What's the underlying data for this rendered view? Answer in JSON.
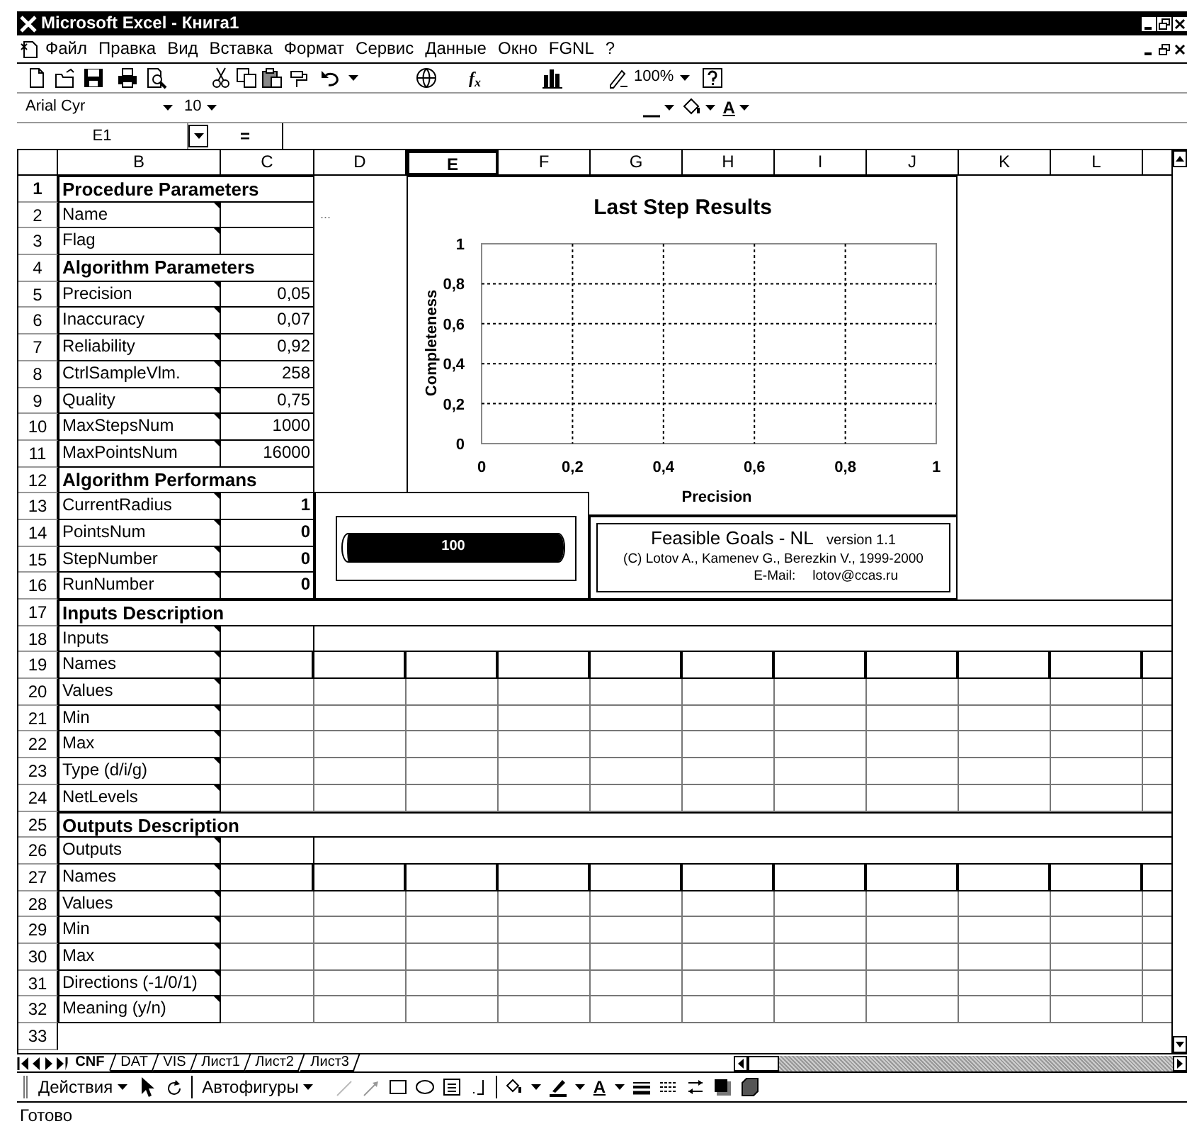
{
  "window": {
    "title": "Microsoft Excel - Книга1"
  },
  "menu": [
    "Файл",
    "Правка",
    "Вид",
    "Вставка",
    "Формат",
    "Сервис",
    "Данные",
    "Окно",
    "FGNL",
    "?"
  ],
  "standard_toolbar": {
    "function_button": "f$_{x}$",
    "zoom": "100%"
  },
  "formatting_toolbar": {
    "font": "Arial Cyr",
    "size": "10",
    "font_color_button": "A"
  },
  "formula_bar": {
    "name_box": "E1",
    "equals_button": "="
  },
  "columns": [
    {
      "label": "B",
      "selected": false
    },
    {
      "label": "C",
      "selected": false
    },
    {
      "label": "D",
      "selected": false
    },
    {
      "label": "E",
      "selected": true
    },
    {
      "label": "F",
      "selected": false
    },
    {
      "label": "G",
      "selected": false
    },
    {
      "label": "H",
      "selected": false
    },
    {
      "label": "I",
      "selected": false
    },
    {
      "label": "J",
      "selected": false
    },
    {
      "label": "K",
      "selected": false
    },
    {
      "label": "L",
      "selected": false
    }
  ],
  "rows": [
    {
      "number": "1",
      "selected": true,
      "kind": "section",
      "label": "Procedure Parameters"
    },
    {
      "number": "2",
      "selected": false,
      "kind": "param",
      "label": "Name",
      "column_d": "..."
    },
    {
      "number": "3",
      "selected": false,
      "kind": "param",
      "label": "Flag"
    },
    {
      "number": "4",
      "selected": false,
      "kind": "section",
      "label": "Algorithm Parameters"
    },
    {
      "number": "5",
      "selected": false,
      "kind": "param",
      "label": "Precision",
      "value": "0,05"
    },
    {
      "number": "6",
      "selected": false,
      "kind": "param",
      "label": "Inaccuracy",
      "value": "0,07"
    },
    {
      "number": "7",
      "selected": false,
      "kind": "param",
      "label": "Reliability",
      "value": "0,92"
    },
    {
      "number": "8",
      "selected": false,
      "kind": "param",
      "label": "CtrlSampleVlm.",
      "value": "258"
    },
    {
      "number": "9",
      "selected": false,
      "kind": "param",
      "label": "Quality",
      "value": "0,75"
    },
    {
      "number": "10",
      "selected": false,
      "kind": "param",
      "label": "MaxStepsNum",
      "value": "1000"
    },
    {
      "number": "11",
      "selected": false,
      "kind": "param",
      "label": "MaxPointsNum",
      "value": "16000"
    },
    {
      "number": "12",
      "selected": false,
      "kind": "section",
      "label": "Algorithm Performans"
    },
    {
      "number": "13",
      "selected": false,
      "kind": "result",
      "label": "CurrentRadius",
      "value": "1"
    },
    {
      "number": "14",
      "selected": false,
      "kind": "result",
      "label": "PointsNum",
      "value": "0"
    },
    {
      "number": "15",
      "selected": false,
      "kind": "result",
      "label": "StepNumber",
      "value": "0"
    },
    {
      "number": "16",
      "selected": false,
      "kind": "result",
      "label": "RunNumber",
      "value": "0"
    },
    {
      "number": "17",
      "selected": false,
      "kind": "section_wide",
      "label": "Inputs Description"
    },
    {
      "number": "18",
      "selected": false,
      "kind": "count",
      "label": "Inputs"
    },
    {
      "number": "19",
      "selected": false,
      "kind": "grid_head",
      "label": "Names"
    },
    {
      "number": "20",
      "selected": false,
      "kind": "grid",
      "label": "Values"
    },
    {
      "number": "21",
      "selected": false,
      "kind": "grid",
      "label": "Min"
    },
    {
      "number": "22",
      "selected": false,
      "kind": "grid",
      "label": "Max"
    },
    {
      "number": "23",
      "selected": false,
      "kind": "grid",
      "label": "Type (d/i/g)"
    },
    {
      "number": "24",
      "selected": false,
      "kind": "grid",
      "label": "NetLevels"
    },
    {
      "number": "25",
      "selected": false,
      "kind": "section_wide",
      "label": "Outputs Description"
    },
    {
      "number": "26",
      "selected": false,
      "kind": "count",
      "label": "Outputs"
    },
    {
      "number": "27",
      "selected": false,
      "kind": "grid_head",
      "label": "Names"
    },
    {
      "number": "28",
      "selected": false,
      "kind": "grid",
      "label": "Values"
    },
    {
      "number": "29",
      "selected": false,
      "kind": "grid",
      "label": "Min"
    },
    {
      "number": "30",
      "selected": false,
      "kind": "grid",
      "label": "Max"
    },
    {
      "number": "31",
      "selected": false,
      "kind": "grid",
      "label": "Directions (-1/0/1)"
    },
    {
      "number": "32",
      "selected": false,
      "kind": "grid",
      "label": "Meaning (y/n)"
    },
    {
      "number": "33",
      "selected": false,
      "kind": "blank"
    }
  ],
  "chart": {
    "chart_data": {
      "type": "scatter",
      "title": "Last Step Results",
      "xlabel": "Precision",
      "ylabel": "Completeness",
      "xlim": [
        0,
        1
      ],
      "ylim": [
        0,
        1
      ],
      "grid": true,
      "xticks": [
        {
          "value": 0,
          "label": "0"
        },
        {
          "value": 0.2,
          "label": "0,2"
        },
        {
          "value": 0.4,
          "label": "0,4"
        },
        {
          "value": 0.6,
          "label": "0,6"
        },
        {
          "value": 0.8,
          "label": "0,8"
        },
        {
          "value": 1,
          "label": "1"
        }
      ],
      "yticks": [
        {
          "value": 0,
          "label": "0"
        },
        {
          "value": 0.2,
          "label": "0,2"
        },
        {
          "value": 0.4,
          "label": "0,4"
        },
        {
          "value": 0.6,
          "label": "0,6"
        },
        {
          "value": 0.8,
          "label": "0,8"
        },
        {
          "value": 1,
          "label": "1"
        }
      ]
    }
  },
  "progress": {
    "level": 1,
    "reading": "100"
  },
  "about": {
    "title": "Feasible Goals - NL",
    "version": "version 1.1",
    "copyright": "(C) Lotov A., Kamenev G., Berezkin V., 1999-2000",
    "email_label": "E-Mail:",
    "email": "lotov@ccas.ru"
  },
  "sheet_tabs": [
    {
      "label": "CNF",
      "selected": true
    },
    {
      "label": "DAT",
      "selected": false
    },
    {
      "label": "VIS",
      "selected": false
    },
    {
      "label": "Лист1",
      "selected": false
    },
    {
      "label": "Лист2",
      "selected": false
    },
    {
      "label": "Лист3",
      "selected": false
    }
  ],
  "drawing_toolbar": {
    "actions": "Действия",
    "autoshapes": "Автофигуры",
    "font_color_button": "A"
  },
  "status_bar": "Готово"
}
